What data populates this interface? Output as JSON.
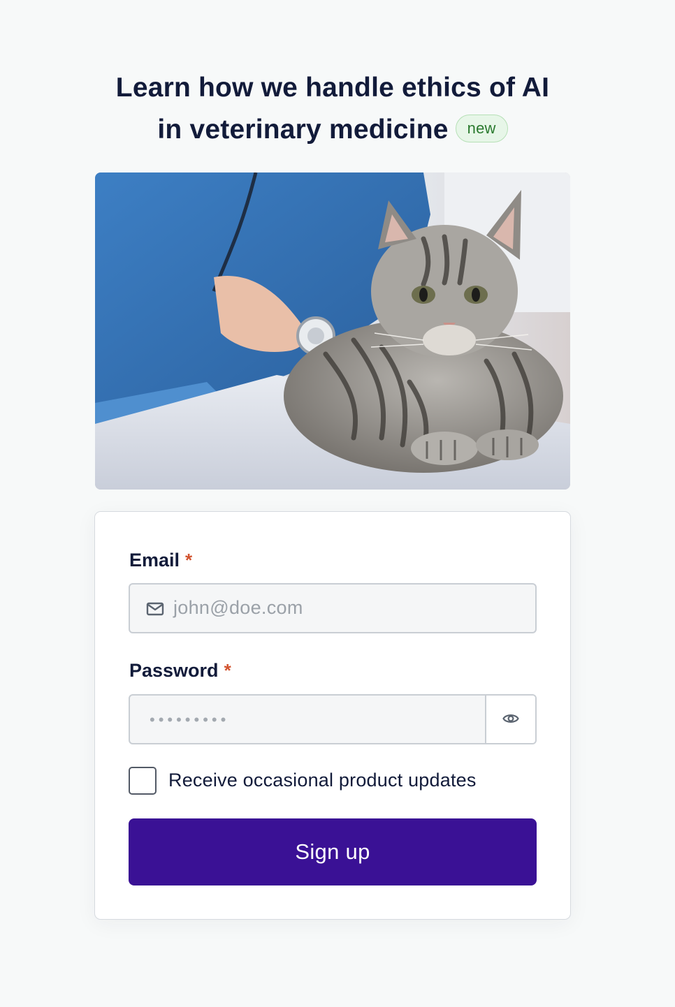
{
  "headline": {
    "line1": "Learn how we handle ethics of AI",
    "line2": "in veterinary medicine",
    "badge": "new"
  },
  "hero_image": {
    "icon": "photo-vet-examining-cat"
  },
  "form": {
    "email": {
      "label": "Email",
      "required_mark": "*",
      "placeholder": "john@doe.com",
      "icon": "mail-icon"
    },
    "password": {
      "label": "Password",
      "required_mark": "*",
      "placeholder": "•••••••••",
      "toggle_icon": "eye-icon"
    },
    "updates_checkbox": {
      "label": "Receive occasional product updates",
      "checked": false
    },
    "submit_label": "Sign up"
  },
  "colors": {
    "background": "#f7f9f9",
    "text": "#121b3a",
    "accent": "#3a1195",
    "required": "#d2532f",
    "badge_text": "#2a7a2e",
    "badge_bg": "#e7f6e8"
  }
}
